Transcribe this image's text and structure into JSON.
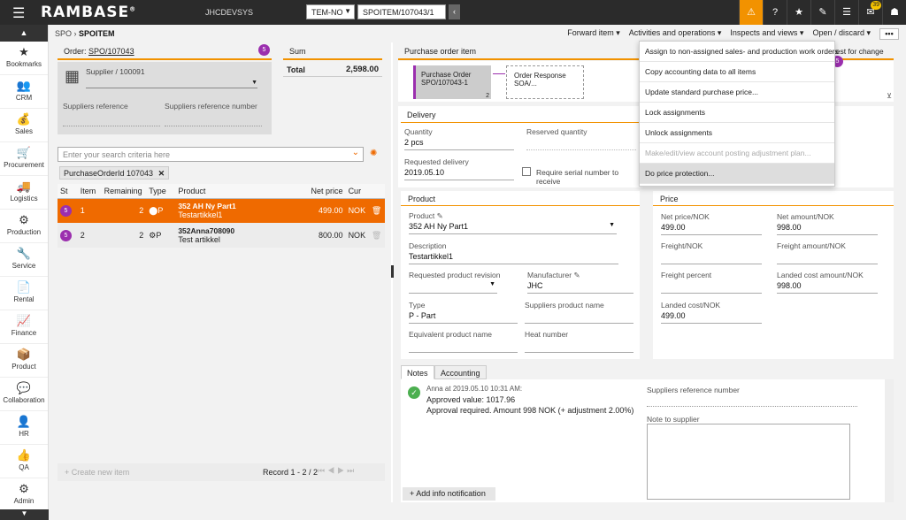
{
  "topbar": {
    "logo": "RAMBASE",
    "logo_mark": "®",
    "system": "JHCDEVSYS",
    "company_select": "TEM-NO",
    "object_field": "SPOITEM/107043/1",
    "notification_count": "39",
    "icons": [
      "warning-icon",
      "help-icon",
      "star-icon",
      "attachment-icon",
      "list-icon",
      "inbox-icon",
      "user-icon"
    ]
  },
  "sidebar": {
    "items": [
      {
        "label": "Bookmarks",
        "icon": "★"
      },
      {
        "label": "CRM",
        "icon": "👥"
      },
      {
        "label": "Sales",
        "icon": "💰"
      },
      {
        "label": "Procurement",
        "icon": "🛒"
      },
      {
        "label": "Logistics",
        "icon": "🚚"
      },
      {
        "label": "Production",
        "icon": "⚙"
      },
      {
        "label": "Service",
        "icon": "🔧"
      },
      {
        "label": "Rental",
        "icon": "📄"
      },
      {
        "label": "Finance",
        "icon": "📈"
      },
      {
        "label": "Product",
        "icon": "📦"
      },
      {
        "label": "Collaboration",
        "icon": "💬"
      },
      {
        "label": "HR",
        "icon": "👤"
      },
      {
        "label": "QA",
        "icon": "👍"
      },
      {
        "label": "Admin",
        "icon": "⚙"
      }
    ]
  },
  "breadcrumb": {
    "root": "SPO",
    "current": "SPOITEM"
  },
  "actions": [
    "Forward item ▾",
    "Activities and operations ▾",
    "Inspects and views ▾",
    "Open / discard ▾"
  ],
  "more_label": "•••",
  "order": {
    "title_label": "Order:",
    "title_value": "SPO/107043",
    "badge": "5",
    "supplier": "Supplier / 100091",
    "supplier_ref_label": "Suppliers reference",
    "supplier_ref_number_label": "Suppliers reference number"
  },
  "sum": {
    "title": "Sum",
    "total_label": "Total",
    "total_value": "2,598.00"
  },
  "search": {
    "placeholder": "Enter your search criteria here"
  },
  "filter_chip": "PurchaseOrderId 107043",
  "grid": {
    "headers": [
      "St",
      "Item",
      "Remaining",
      "Type",
      "Product",
      "Net price",
      "Cur"
    ],
    "rows": [
      {
        "st": "5",
        "item": "1",
        "remaining": "2",
        "type": "P",
        "product": "352 AH Ny Part1",
        "desc": "Testartikkel1",
        "net": "499.00",
        "cur": "NOK"
      },
      {
        "st": "5",
        "item": "2",
        "remaining": "2",
        "type": "P",
        "product": "352Anna708090",
        "desc": "Test artikkel",
        "net": "800.00",
        "cur": "NOK"
      }
    ]
  },
  "left_footer": {
    "create": "Create new item",
    "record": "Record 1 - 2 / 2"
  },
  "poitem": {
    "title": "Purchase order item",
    "node1_label": "Purchase Order",
    "node1_value": "SPO/107043-1",
    "node1_count": "2",
    "node2_label": "Order Response",
    "node2_value": "SOA/...",
    "request_label": "uest for change",
    "request_badge": "5"
  },
  "delivery": {
    "title": "Delivery",
    "quantity_label": "Quantity",
    "quantity_value": "2 pcs",
    "reserved_label": "Reserved quantity",
    "requested_label": "Requested delivery",
    "requested_value": "2019.05.10",
    "serial_label": "Require serial number to receive"
  },
  "product": {
    "title": "Product",
    "product_label": "Product",
    "product_value": "352 AH Ny Part1",
    "description_label": "Description",
    "description_value": "Testartikkel1",
    "revision_label": "Requested product revision",
    "manufacturer_label": "Manufacturer",
    "manufacturer_value": "JHC",
    "type_label": "Type",
    "type_value": "P - Part",
    "supplier_product_label": "Suppliers product name",
    "equivalent_label": "Equivalent product name",
    "heat_label": "Heat number"
  },
  "price": {
    "title": "Price",
    "net_price_label": "Net price/NOK",
    "net_price_value": "499.00",
    "net_amount_label": "Net amount/NOK",
    "net_amount_value": "998.00",
    "freight_label": "Freight/NOK",
    "freight_amount_label": "Freight amount/NOK",
    "freight_percent_label": "Freight percent",
    "landed_amount_label": "Landed cost amount/NOK",
    "landed_amount_value": "998.00",
    "landed_label": "Landed cost/NOK",
    "landed_value": "499.00"
  },
  "tabs": [
    "Notes",
    "Accounting"
  ],
  "note": {
    "author": "Anna",
    "timestamp": "at 2019.05.10 10:31 AM:",
    "line1": "Approved value: 1017.96",
    "line2": "Approval required. Amount 998 NOK (+ adjustment 2.00%)",
    "add_label": "Add info notification",
    "supplier_ref_label": "Suppliers reference number",
    "note_to_supplier_label": "Note to supplier"
  },
  "menu": {
    "items": [
      "Assign to non-assigned sales- and production work orders",
      "Copy accounting data to all items",
      "Update standard purchase price...",
      "Lock assignments",
      "Unlock assignments",
      "Make/edit/view account posting adjustment plan...",
      "Do price protection..."
    ]
  },
  "colors": {
    "accent": "#ef6a00",
    "badge": "#9b2fae",
    "topbar": "#2b2b2b",
    "warning": "#f29200"
  }
}
